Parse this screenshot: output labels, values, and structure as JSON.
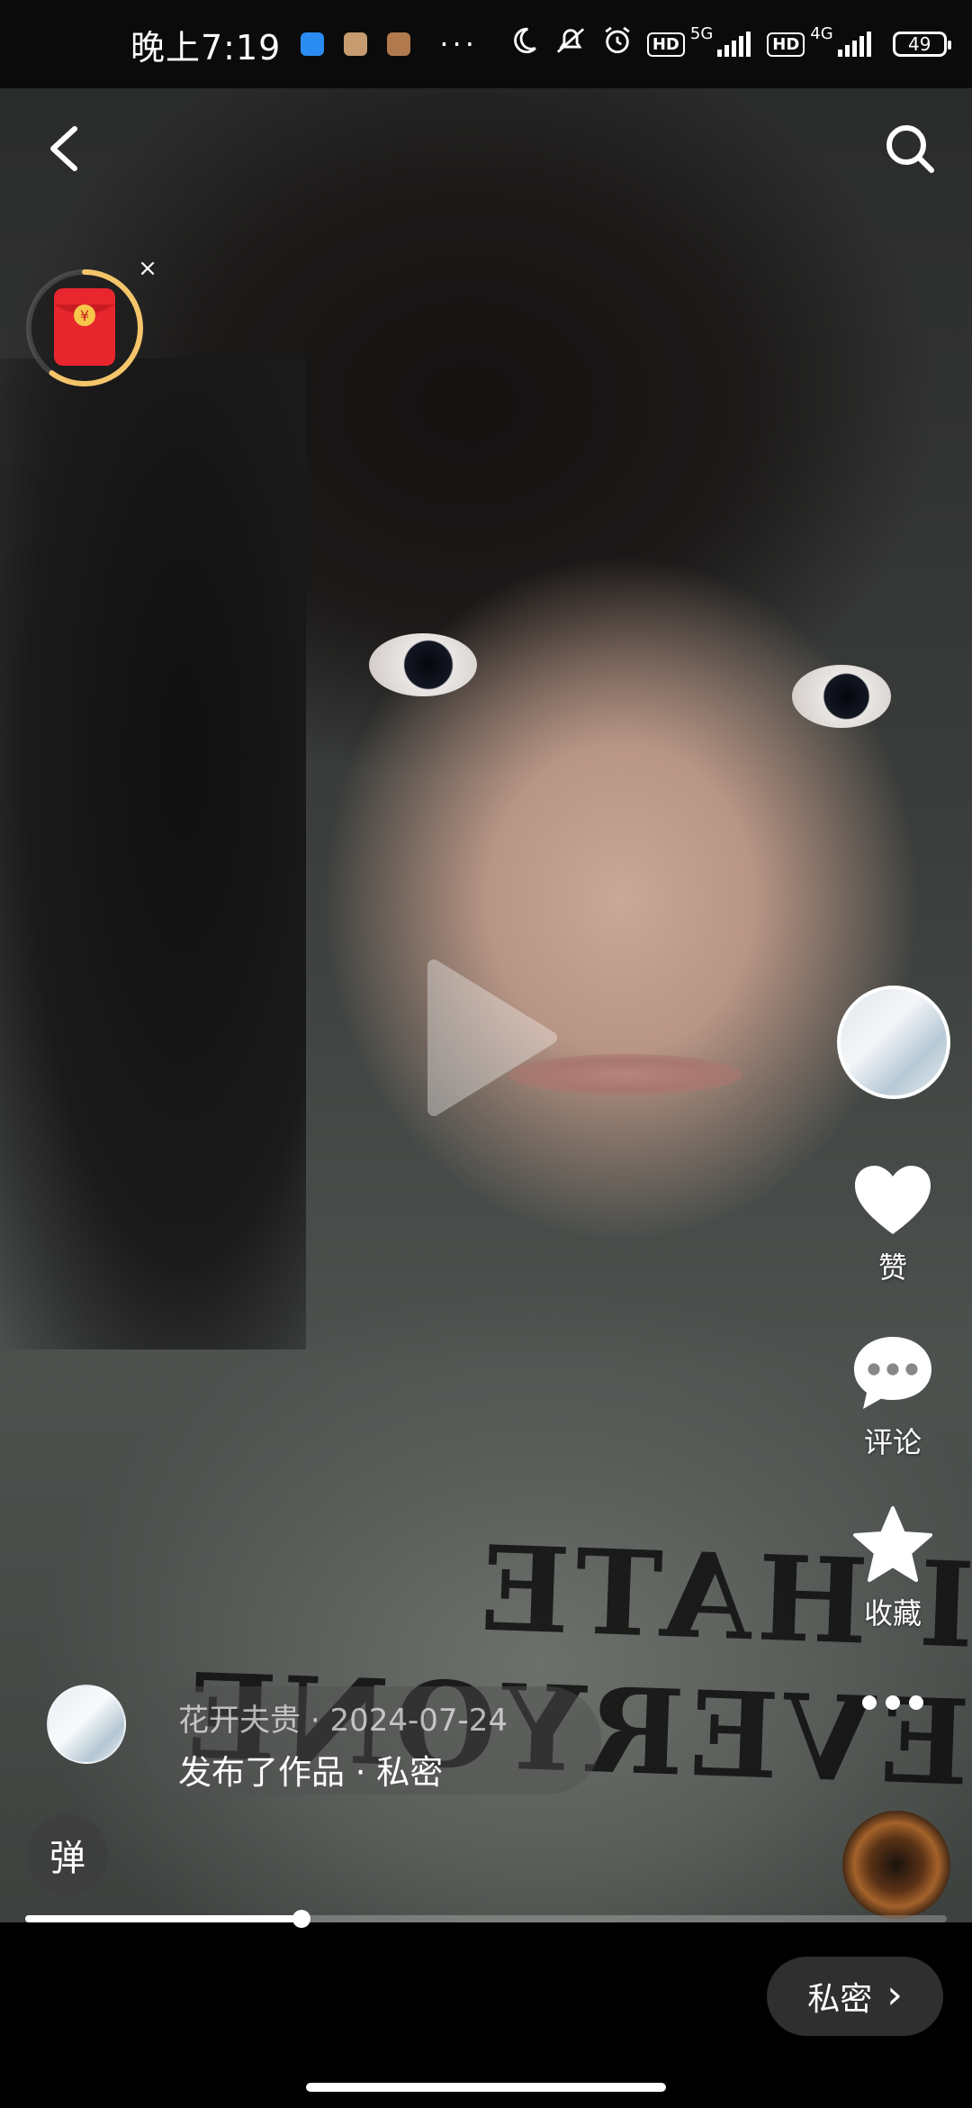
{
  "status_bar": {
    "time": "晚上7:19",
    "more": "···",
    "hd1": "HD",
    "net1": "5G",
    "hd2": "HD",
    "net2": "4G",
    "battery": "49",
    "icons": [
      "app-icon-blue",
      "app-icon-tan",
      "app-icon-tan2",
      "moon-icon",
      "mute-icon",
      "alarm-icon"
    ]
  },
  "top_bar": {
    "back_icon": "chevron-left-icon",
    "search_icon": "search-icon"
  },
  "red_packet": {
    "icon": "red-envelope-icon",
    "symbol": "¥",
    "close": "×",
    "ring_progress_percent": 60
  },
  "right_rail": {
    "like_label": "赞",
    "comment_label": "评论",
    "favorite_label": "收藏",
    "more_icon": "more-dots-icon"
  },
  "post": {
    "author_name": "花开夫贵",
    "date": "2024-07-24",
    "meta_separator": "·",
    "action_text": "发布了作品 · 私密"
  },
  "danmaku": {
    "label": "弹"
  },
  "playback": {
    "progress_percent": 30
  },
  "bottom": {
    "private_label": "私密",
    "private_chevron": "›"
  },
  "colors": {
    "accent_gold": "#f5c56a",
    "red_envelope": "#e8262e"
  }
}
